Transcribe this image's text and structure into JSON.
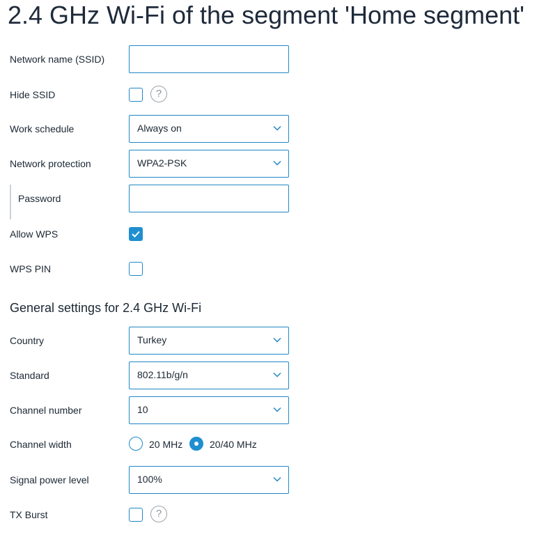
{
  "page_title": "2.4 GHz Wi-Fi of the segment 'Home segment'",
  "fields": {
    "ssid": {
      "label": "Network name (SSID)",
      "value": ""
    },
    "hide_ssid": {
      "label": "Hide SSID",
      "checked": false,
      "help": "?"
    },
    "work_schedule": {
      "label": "Work schedule",
      "value": "Always on"
    },
    "network_protection": {
      "label": "Network protection",
      "value": "WPA2-PSK"
    },
    "password": {
      "label": "Password",
      "value": ""
    },
    "allow_wps": {
      "label": "Allow WPS",
      "checked": true
    },
    "wps_pin": {
      "label": "WPS PIN",
      "checked": false
    }
  },
  "general": {
    "title": "General settings for 2.4 GHz Wi-Fi",
    "country": {
      "label": "Country",
      "value": "Turkey"
    },
    "standard": {
      "label": "Standard",
      "value": "802.11b/g/n"
    },
    "channel_number": {
      "label": "Channel number",
      "value": "10"
    },
    "channel_width": {
      "label": "Channel width",
      "options": [
        "20 MHz",
        "20/40 MHz"
      ],
      "selected": "20/40 MHz"
    },
    "signal_power": {
      "label": "Signal power level",
      "value": "100%"
    },
    "tx_burst": {
      "label": "TX Burst",
      "checked": false,
      "help": "?"
    }
  },
  "colors": {
    "accent": "#1f8fd0",
    "border": "#1f87c5",
    "text": "#1b2733"
  }
}
